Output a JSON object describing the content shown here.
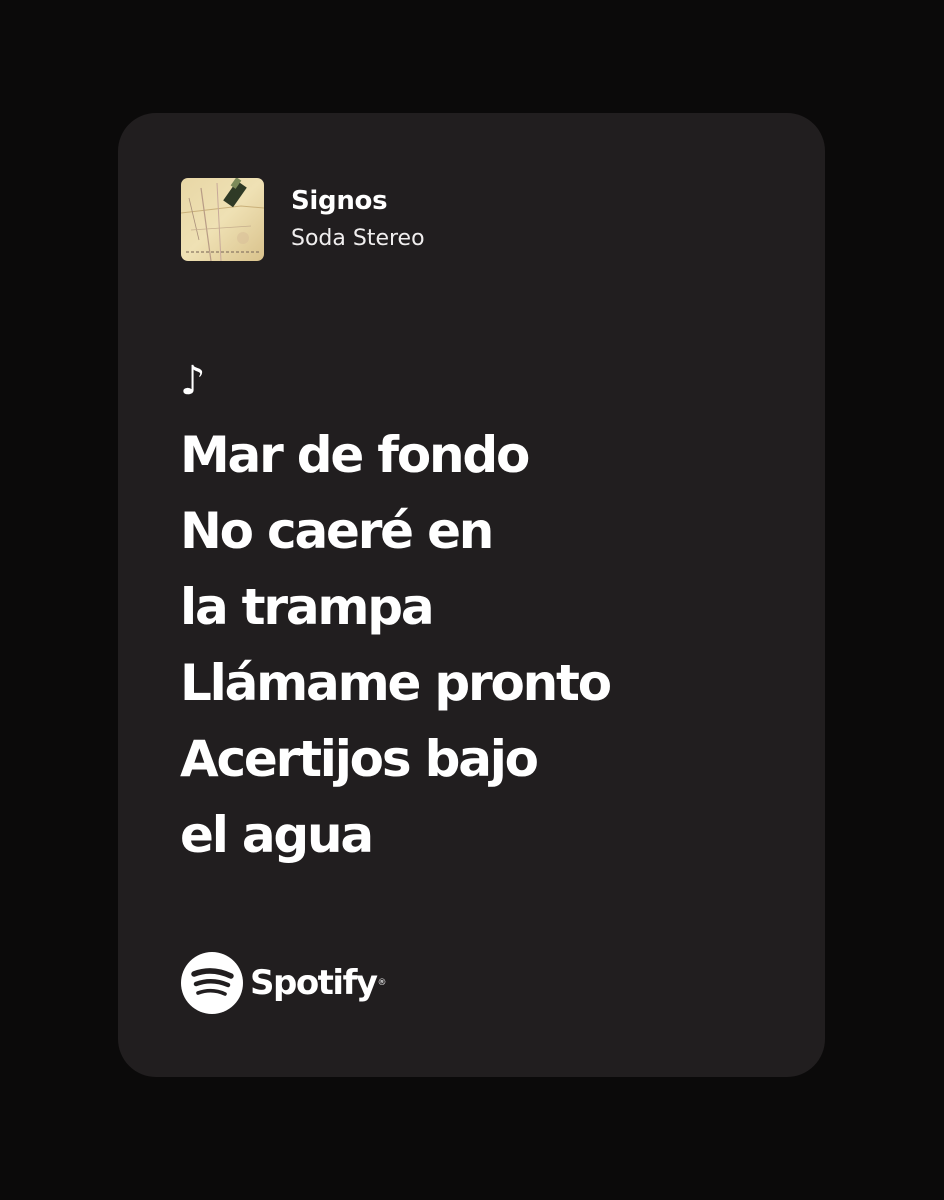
{
  "track": {
    "title": "Signos",
    "artist": "Soda Stereo"
  },
  "note_icon": "music-note-icon",
  "lyrics": [
    "Mar de fondo",
    "No caeré en",
    "la trampa",
    "Llámame pronto",
    "Acertijos bajo",
    "el agua"
  ],
  "brand": {
    "name": "Spotify",
    "icon": "spotify-logo-icon"
  },
  "colors": {
    "background": "#0b0a0a",
    "card": "#211e1f",
    "text": "#ffffff"
  }
}
